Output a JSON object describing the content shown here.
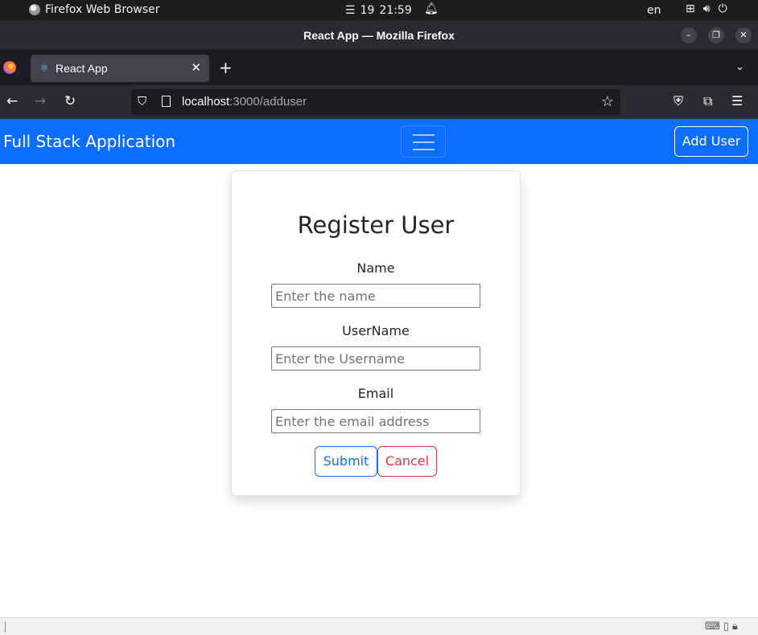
{
  "system_bar": {
    "app_name": "Firefox Web Browser",
    "notification_glyph": "☰",
    "date": "19",
    "time": "21:59",
    "language": "en"
  },
  "window": {
    "title": "React App — Mozilla Firefox"
  },
  "tabs": [
    {
      "label": "React App",
      "active": true
    }
  ],
  "url": {
    "host": "localhost",
    "path": ":3000/adduser"
  },
  "app": {
    "brand": "Full Stack Application",
    "add_user_label": "Add User",
    "accent_color": "#0d6efd"
  },
  "form": {
    "heading": "Register User",
    "fields": [
      {
        "label": "Name",
        "placeholder": "Enter the name",
        "value": ""
      },
      {
        "label": "UserName",
        "placeholder": "Enter the Username",
        "value": ""
      },
      {
        "label": "Email",
        "placeholder": "Enter the email address",
        "value": ""
      }
    ],
    "submit_label": "Submit",
    "cancel_label": "Cancel",
    "submit_color": "#0d6efd",
    "cancel_color": "#dc3545"
  }
}
